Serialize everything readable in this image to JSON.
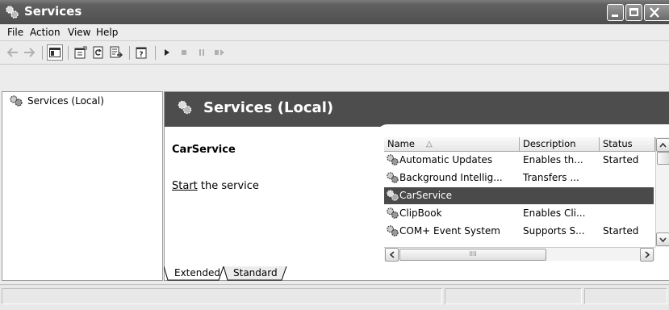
{
  "window": {
    "title": "Services"
  },
  "menu": [
    "File",
    "Action",
    "View",
    "Help"
  ],
  "toolbar": {
    "buttons": [
      "back-icon",
      "forward-icon",
      "show-hide-tree-icon",
      "properties-icon",
      "refresh-icon",
      "export-list-icon",
      "help-icon",
      "play-icon",
      "stop-icon",
      "pause-icon",
      "restart-icon"
    ]
  },
  "tree": {
    "root_label": "Services (Local)"
  },
  "right_pane": {
    "header_title": "Services (Local)",
    "selected_service": "CarService",
    "action_link": "Start",
    "action_rest": " the service"
  },
  "list": {
    "columns": [
      "Name",
      "Description",
      "Status"
    ],
    "rows": [
      {
        "name": "Automatic Updates",
        "description": "Enables th...",
        "status": "Started"
      },
      {
        "name": "Background Intellig...",
        "description": "Transfers ...",
        "status": ""
      },
      {
        "name": "CarService",
        "description": "",
        "status": ""
      },
      {
        "name": "ClipBook",
        "description": "Enables Cli...",
        "status": ""
      },
      {
        "name": "COM+ Event System",
        "description": "Supports S...",
        "status": "Started"
      }
    ],
    "selected_index": 2,
    "sort_indicator": "△",
    "hscroll_grip": "IIII"
  },
  "tabs": [
    "Extended",
    "Standard"
  ],
  "colors": {
    "title_bar": "#585858",
    "selection": "#4a4a4a",
    "header_band": "#4d4d4d"
  }
}
